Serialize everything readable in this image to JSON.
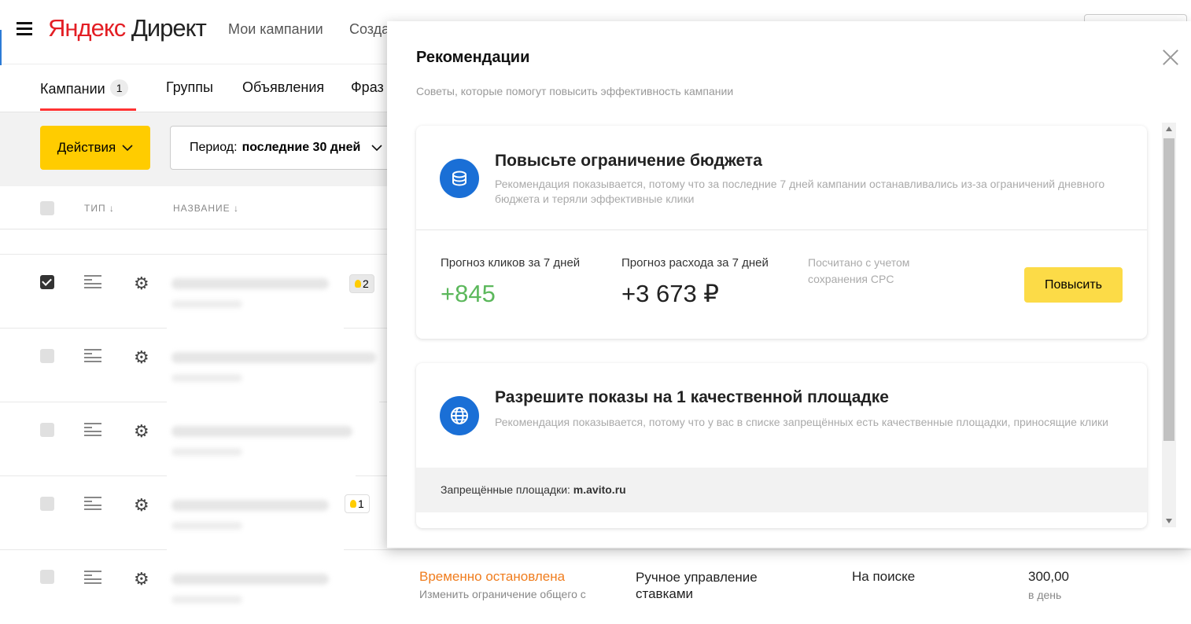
{
  "header": {
    "logo_part1": "Яндекс",
    "logo_part2": "Директ",
    "nav": [
      "Мои кампании",
      "Созда"
    ]
  },
  "tabs": [
    {
      "label": "Кампании",
      "count": "1"
    },
    {
      "label": "Группы"
    },
    {
      "label": "Объявления"
    },
    {
      "label": "Фраз"
    }
  ],
  "toolbar": {
    "actions_label": "Действия",
    "period_label": "Период:",
    "period_value": "последние 30 дней"
  },
  "table": {
    "col_type": "ТИП",
    "col_name": "НАЗВАНИЕ",
    "rows": [
      {
        "checked": true,
        "badge": "2"
      },
      {
        "checked": false,
        "badge": ""
      },
      {
        "checked": false,
        "badge": ""
      },
      {
        "checked": false,
        "badge": "1"
      },
      {
        "checked": false,
        "badge": ""
      }
    ],
    "last_row": {
      "status": "Временно остановлена",
      "status_sub": "Изменить ограничение общего с",
      "strategy": "Ручное управление ставками",
      "placement": "На поиске",
      "budget": "300,00",
      "budget_unit": "в день"
    }
  },
  "panel": {
    "title": "Рекомендации",
    "subtitle": "Советы, которые помогут повысить эффективность кампании",
    "card1": {
      "title": "Повысьте ограничение бюджета",
      "desc": "Рекомендация показывается, потому что за последние 7 дней кампании останавливались из-за ограничений дневного бюджета и теряли эффективные клики",
      "clicks_label": "Прогноз кликов за 7 дней",
      "clicks_value": "+845",
      "cost_label": "Прогноз расхода за 7 дней",
      "cost_value": "+3 673 ₽",
      "note": "Посчитано с учетом сохранения CPC",
      "button": "Повысить"
    },
    "card2": {
      "title": "Разрешите показы на 1 качественной площадке",
      "desc": "Рекомендация показывается, потому что у вас в списке запрещённых есть качественные площадки, приносящие клики",
      "banned_label": "Запрещённые площадки:",
      "banned_value": "m.avito.ru"
    }
  },
  "colors": {
    "accent_yellow": "#ffcc00",
    "positive_green": "#5cb85c",
    "icon_blue": "#1a6fd6",
    "status_orange": "#f07d1e",
    "brand_red": "#e31e24"
  }
}
